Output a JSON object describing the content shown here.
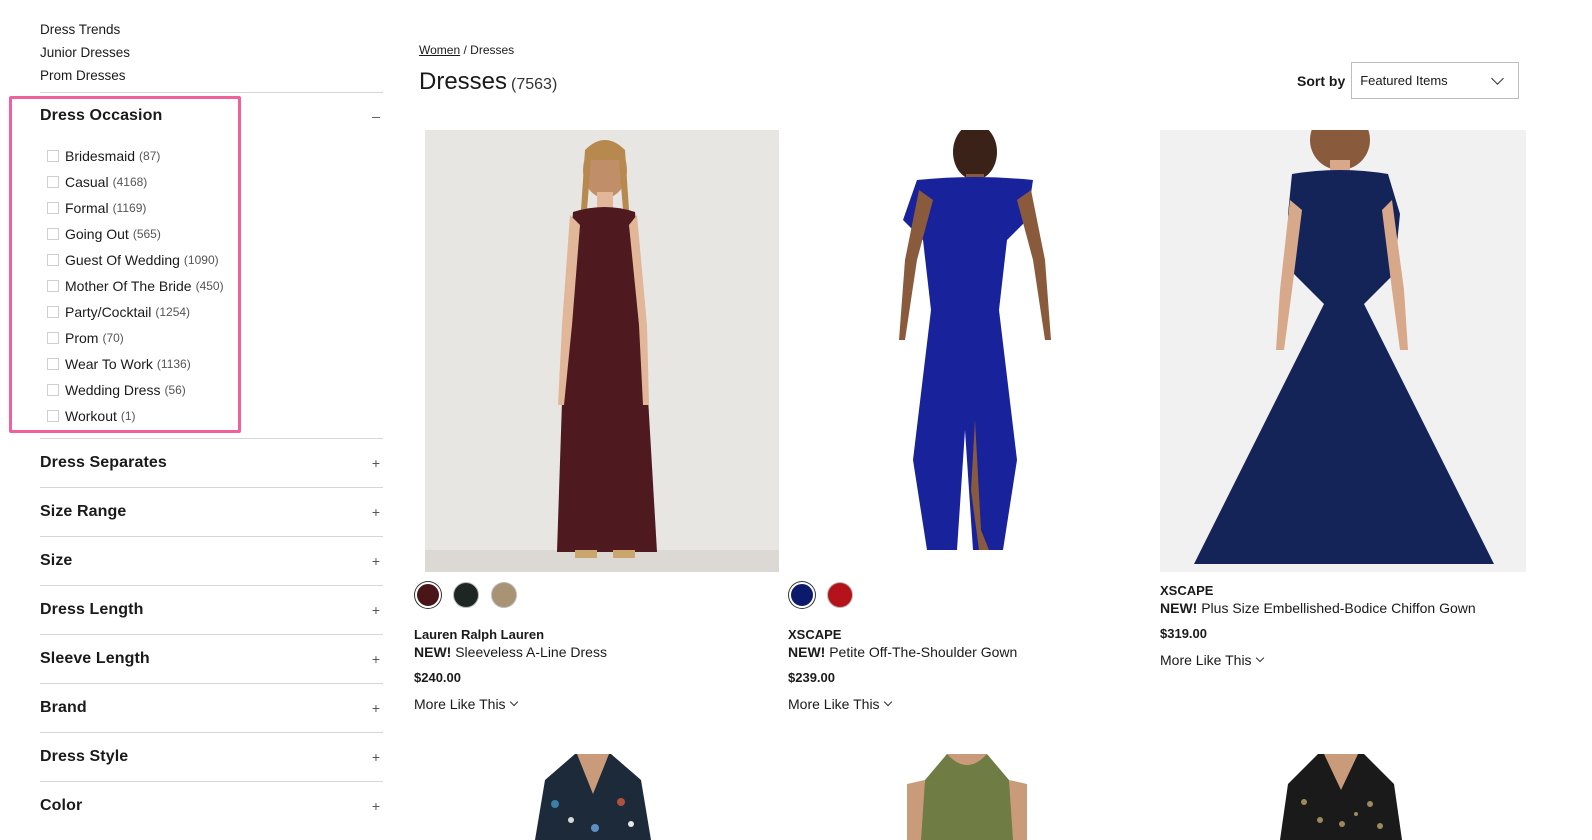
{
  "sidebar": {
    "top_links": [
      "Dress Trends",
      "Junior Dresses",
      "Prom Dresses"
    ],
    "occasion": {
      "title": "Dress Occasion",
      "toggle": "–",
      "options": [
        {
          "label": "Bridesmaid",
          "count": "(87)"
        },
        {
          "label": "Casual",
          "count": "(4168)"
        },
        {
          "label": "Formal",
          "count": "(1169)"
        },
        {
          "label": "Going Out",
          "count": "(565)"
        },
        {
          "label": "Guest Of Wedding",
          "count": "(1090)"
        },
        {
          "label": "Mother Of The Bride",
          "count": "(450)"
        },
        {
          "label": "Party/Cocktail",
          "count": "(1254)"
        },
        {
          "label": "Prom",
          "count": "(70)"
        },
        {
          "label": "Wear To Work",
          "count": "(1136)"
        },
        {
          "label": "Wedding Dress",
          "count": "(56)"
        },
        {
          "label": "Workout",
          "count": "(1)"
        }
      ]
    },
    "sections": [
      {
        "title": "Dress Separates",
        "toggle": "+"
      },
      {
        "title": "Size Range",
        "toggle": "+"
      },
      {
        "title": "Size",
        "toggle": "+"
      },
      {
        "title": "Dress Length",
        "toggle": "+"
      },
      {
        "title": "Sleeve Length",
        "toggle": "+"
      },
      {
        "title": "Brand",
        "toggle": "+"
      },
      {
        "title": "Dress Style",
        "toggle": "+"
      },
      {
        "title": "Color",
        "toggle": "+"
      }
    ]
  },
  "breadcrumb": {
    "parent": "Women",
    "separator": "/",
    "current": "Dresses"
  },
  "page": {
    "title": "Dresses",
    "count": "(7563)"
  },
  "sort": {
    "label": "Sort by",
    "value": "Featured Items"
  },
  "products": [
    {
      "brand": "Lauren Ralph Lauren",
      "badge": "NEW!",
      "name": "Sleeveless A-Line Dress",
      "price": "$240.00",
      "more": "More Like This",
      "swatches": [
        "#4a1518",
        "#1e2623",
        "#a89375"
      ],
      "dress_color": "#4e1a1f",
      "bg": "#e8e6e3"
    },
    {
      "brand": "XSCAPE",
      "badge": "NEW!",
      "name": "Petite Off-The-Shoulder Gown",
      "price": "$239.00",
      "more": "More Like This",
      "swatches": [
        "#0c1a6b",
        "#b5121b"
      ],
      "dress_color": "#18229a",
      "bg": "#ffffff"
    },
    {
      "brand": "XSCAPE",
      "badge": "NEW!",
      "name": "Plus Size Embellished-Bodice Chiffon Gown",
      "price": "$319.00",
      "more": "More Like This",
      "swatches": [],
      "dress_color": "#142458",
      "bg": "#f1f1f1"
    }
  ]
}
